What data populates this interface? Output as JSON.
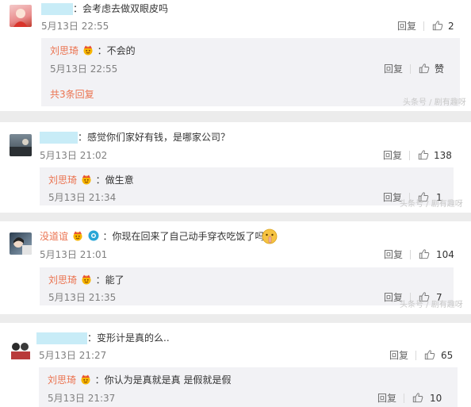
{
  "comments": [
    {
      "text": "：会考虑去做双眼皮吗",
      "time": "5月13日 22:55",
      "reply_label": "回复",
      "like_count": "2",
      "replies": [
        {
          "name": "刘思琦",
          "text": "：不会的",
          "time": "5月13日 22:55",
          "reply_label": "回复",
          "like_count": "赞"
        }
      ],
      "more_link": "共3条回复",
      "watermark": "头条号 / 剧有趣呀"
    },
    {
      "text": "：感觉你们家好有钱，是哪家公司？",
      "time": "5月13日 21:02",
      "reply_label": "回复",
      "like_count": "138",
      "replies": [
        {
          "name": "刘思琦",
          "text": "：做生意",
          "time": "5月13日 21:34",
          "reply_label": "回复",
          "like_count": "1"
        }
      ],
      "watermark": "头条号 / 剧有趣呀"
    },
    {
      "name": "没道谊",
      "text": "：你现在回来了自己动手穿衣吃饭了吗",
      "time": "5月13日 21:01",
      "reply_label": "回复",
      "like_count": "104",
      "replies": [
        {
          "name": "刘思琦",
          "text": "：能了",
          "time": "5月13日 21:35",
          "reply_label": "回复",
          "like_count": "7"
        }
      ],
      "watermark": "头条号 / 剧有趣呀"
    },
    {
      "text": "：变形计是真的么..",
      "time": "5月13日 21:27",
      "reply_label": "回复",
      "like_count": "65",
      "replies": [
        {
          "name": "刘思琦",
          "text": "：你认为是真就是真 是假就是假",
          "time": "5月13日 21:37",
          "reply_label": "回复",
          "like_count": "10"
        }
      ]
    }
  ],
  "icons": {
    "like": "thumbs-up-icon",
    "vip": "vip-crown-badge-icon",
    "camera": "camera-badge-icon",
    "emoji": "shush-face-emoji-icon"
  },
  "colors": {
    "name": "#eb7350",
    "redaction": "#c8ecf7",
    "reply_box": "#f2f2f5",
    "background": "#ececec"
  }
}
